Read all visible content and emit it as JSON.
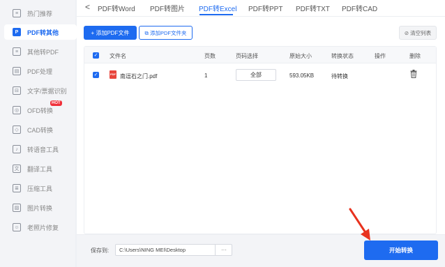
{
  "sidebar": {
    "items": [
      {
        "label": "热门推荐",
        "icon": "fire-icon",
        "glyph": "≡"
      },
      {
        "label": "PDF转其他",
        "icon": "pdf-convert-icon",
        "glyph": "P",
        "active": true
      },
      {
        "label": "其他转PDF",
        "icon": "file-to-pdf-icon",
        "glyph": "≡"
      },
      {
        "label": "PDF处理",
        "icon": "pdf-process-icon",
        "glyph": "▤"
      },
      {
        "label": "文字/票据识别",
        "icon": "ocr-icon",
        "glyph": "⊟"
      },
      {
        "label": "OFD转换",
        "icon": "ofd-icon",
        "glyph": "◎"
      },
      {
        "label": "CAD转换",
        "icon": "cad-icon",
        "glyph": "◇"
      },
      {
        "label": "转语音工具",
        "icon": "voice-icon",
        "glyph": "♪"
      },
      {
        "label": "翻译工具",
        "icon": "translate-icon",
        "glyph": "文"
      },
      {
        "label": "压缩工具",
        "icon": "compress-icon",
        "glyph": "≣"
      },
      {
        "label": "图片转换",
        "icon": "image-icon",
        "glyph": "▨"
      },
      {
        "label": "老照片修复",
        "icon": "photo-repair-icon",
        "glyph": "☺"
      }
    ],
    "hot_badge": "HOT"
  },
  "tabs": {
    "back": "<",
    "items": [
      "PDF转Word",
      "PDF转图片",
      "PDF转Excel",
      "PDF转PPT",
      "PDF转TXT",
      "PDF转CAD"
    ],
    "active": "PDF转Excel"
  },
  "toolbar": {
    "add_file": "+ 添加PDF文件",
    "add_folder": "⧉ 添加PDF文件夹",
    "clear_list": "⊘ 清空列表"
  },
  "table": {
    "headers": [
      "文件名",
      "页数",
      "页码选择",
      "原始大小",
      "转换状态",
      "操作",
      "删除"
    ],
    "rows": [
      {
        "filename": "南逗石之门.pdf",
        "pages": "1",
        "page_select": "全部",
        "size": "593.05KB",
        "status": "待转换",
        "action": ""
      }
    ]
  },
  "footer": {
    "save_label": "保存到:",
    "path": "C:\\Users\\NING MEI\\Desktop",
    "more": "···",
    "start": "开始转换"
  },
  "colors": {
    "accent": "#1e6bf0",
    "annotation_arrow": "#e8321e"
  }
}
